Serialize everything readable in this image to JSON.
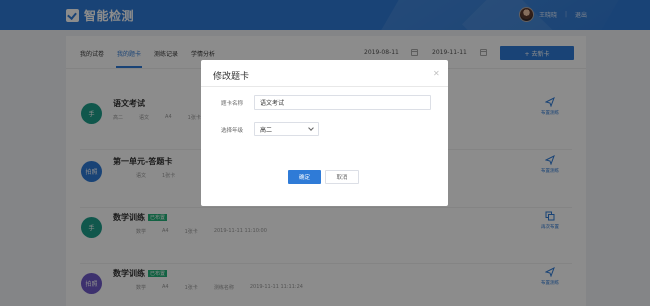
{
  "app": {
    "title": "智能检测"
  },
  "user": {
    "name": "王晓晓",
    "logout": "退出"
  },
  "tabs": [
    {
      "label": "我的试卷"
    },
    {
      "label": "我的题卡"
    },
    {
      "label": "测练记录"
    },
    {
      "label": "学情分析"
    }
  ],
  "filters": {
    "start_date": "2019-08-11",
    "end_date": "2019-11-11"
  },
  "add_button": "+ 去新卡",
  "rows": [
    {
      "circle": "手",
      "circle_color": "#1e9e8a",
      "title": "语文考试",
      "badge": "",
      "meta": [
        "高二",
        "语文",
        "A4",
        "1张卡",
        "",
        ""
      ],
      "action": "布置测练",
      "action_icon": "send-icon"
    },
    {
      "circle": "拍照",
      "circle_color": "#2f7bd7",
      "title": "第一单元-答题卡",
      "badge": "",
      "meta": [
        "",
        "语文",
        "1张卡",
        "",
        "",
        ""
      ],
      "action": "布置测练",
      "action_icon": "send-icon"
    },
    {
      "circle": "手",
      "circle_color": "#1e9e8a",
      "title": "数学训练",
      "badge": "已布置",
      "meta": [
        "",
        "数学",
        "A4",
        "1张卡",
        "2019-11-11 11:10:00",
        ""
      ],
      "action": "再次布置",
      "action_icon": "copy-icon"
    },
    {
      "circle": "拍照",
      "circle_color": "#6f59c9",
      "title": "数学训练",
      "badge": "已布置",
      "meta": [
        "",
        "数学",
        "A4",
        "1张卡",
        "测练名称",
        "2019-11-11 11:11:24"
      ],
      "action": "布置测练",
      "action_icon": "send-icon"
    }
  ],
  "modal": {
    "title": "修改题卡",
    "close_icon": "close-icon",
    "name_label": "题卡名称",
    "name_value": "语文考试",
    "grade_label": "选择年级",
    "grade_value": "高二",
    "ok_label": "确定",
    "cancel_label": "取消"
  },
  "colors": {
    "primary": "#2f7bd7",
    "success": "#23b37a",
    "overlay": "rgba(0,0,0,0.45)"
  }
}
